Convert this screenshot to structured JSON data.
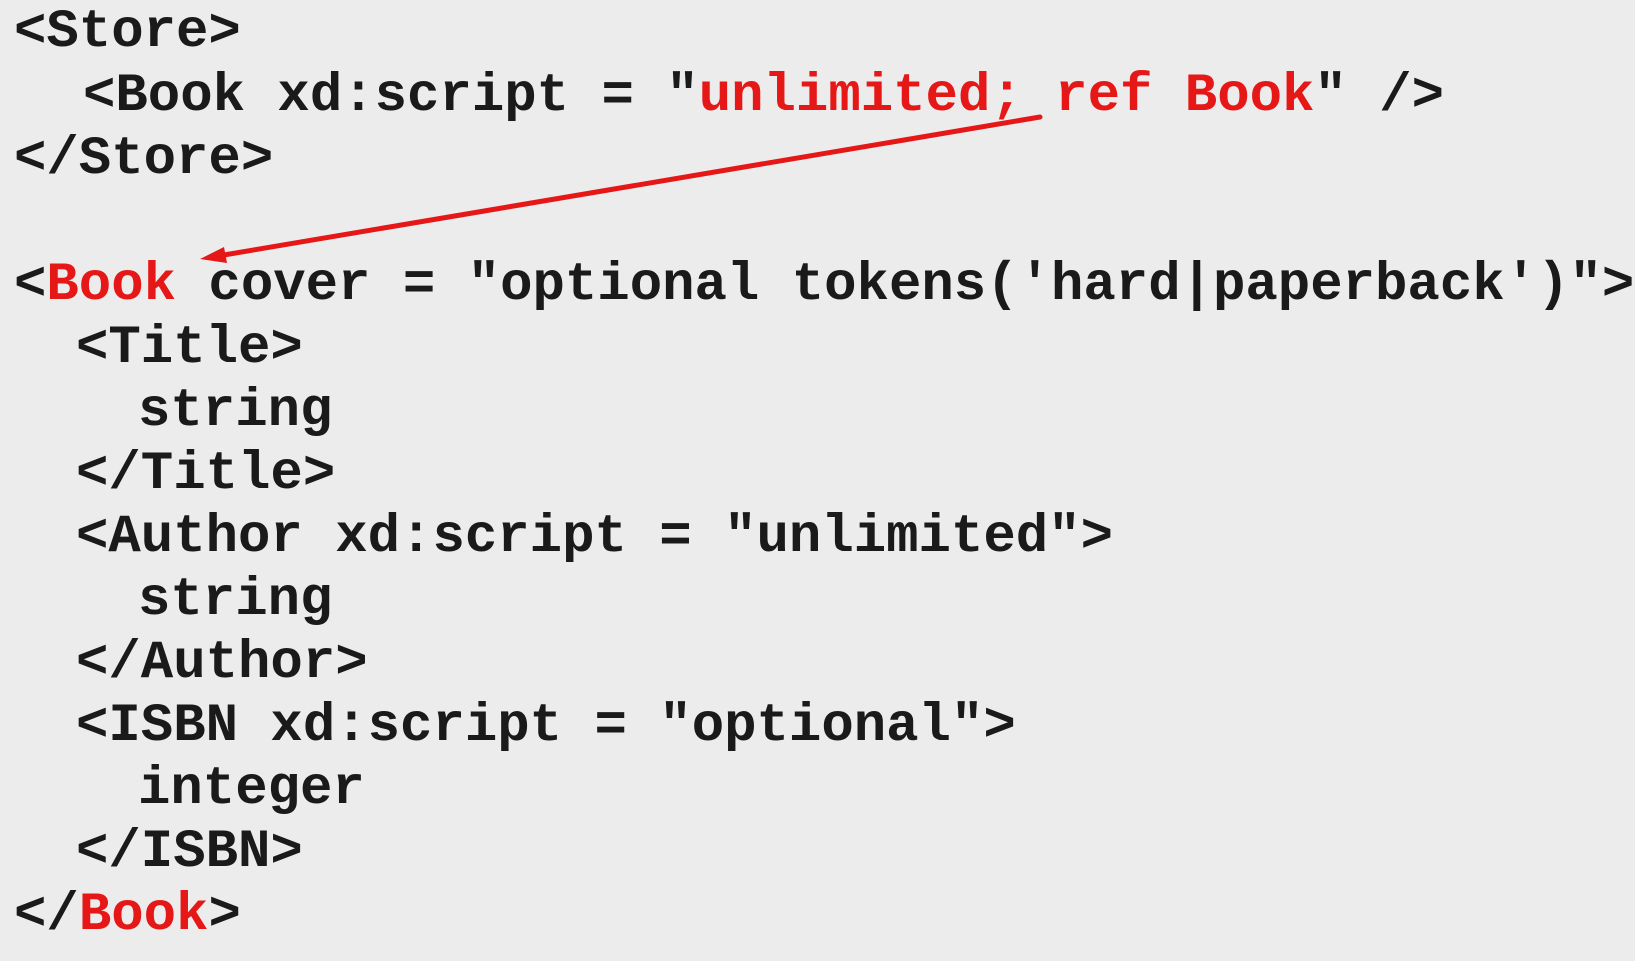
{
  "colors": {
    "background": "#ececec",
    "text": "#1a1a1a",
    "highlight": "#e61717"
  },
  "lines": {
    "store_open": "<Store>",
    "book_ref_a": "<Book xd:script = \"",
    "book_ref_hl": "unlimited; ref Book",
    "book_ref_b": "\" />",
    "store_close": "</Store>",
    "book_def_a": "<",
    "book_def_hl": "Book",
    "book_def_b": " cover = \"optional tokens('hard|paperback')\">",
    "title_open": "<Title>",
    "title_value": "string",
    "title_close": "</Title>",
    "author_open": "<Author xd:script = \"unlimited\">",
    "author_value": "string",
    "author_close": "</Author>",
    "isbn_open": "<ISBN xd:script = \"optional\">",
    "isbn_value": "integer",
    "isbn_close": "</ISBN>",
    "book_close_a": "</",
    "book_close_hl": "Book",
    "book_close_b": ">"
  },
  "arrow": {
    "from": "ref Book",
    "to": "Book",
    "color": "#e61717"
  }
}
